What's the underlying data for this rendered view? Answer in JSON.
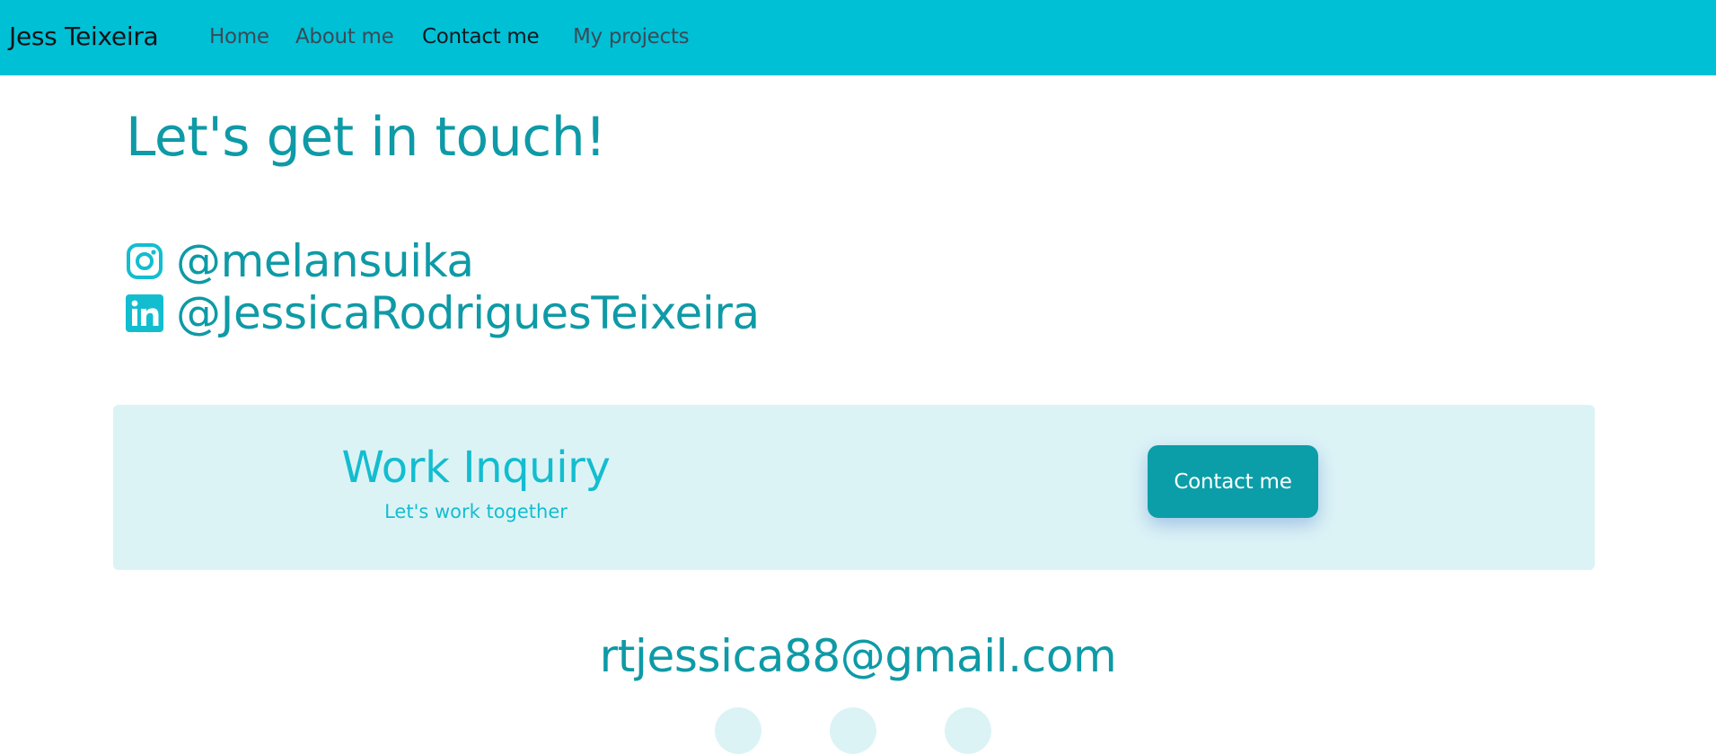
{
  "nav": {
    "brand": "Jess Teixeira",
    "links": [
      {
        "label": "Home",
        "active": false
      },
      {
        "label": "About me",
        "active": false
      },
      {
        "label": "Contact me",
        "active": true
      },
      {
        "label": "My projects",
        "active": false
      }
    ]
  },
  "main": {
    "headline": "Let's get in touch!",
    "socials": [
      {
        "icon": "instagram-icon",
        "handle": "@melansuika"
      },
      {
        "icon": "linkedin-icon",
        "handle": "@JessicaRodriguesTeixeira"
      }
    ]
  },
  "inquiry": {
    "title": "Work Inquiry",
    "subtitle": "Let's work together",
    "button_label": "Contact me"
  },
  "footer": {
    "email": "rtjessica88@gmail.com",
    "icons": [
      "social-icon",
      "social-icon",
      "social-icon"
    ]
  },
  "colors": {
    "navbar": "#00c0d6",
    "accent_text": "#0e9aa6",
    "light_accent": "#13bdd0",
    "panel_bg": "#dcf3f6",
    "button_bg": "#0b9ea8"
  }
}
